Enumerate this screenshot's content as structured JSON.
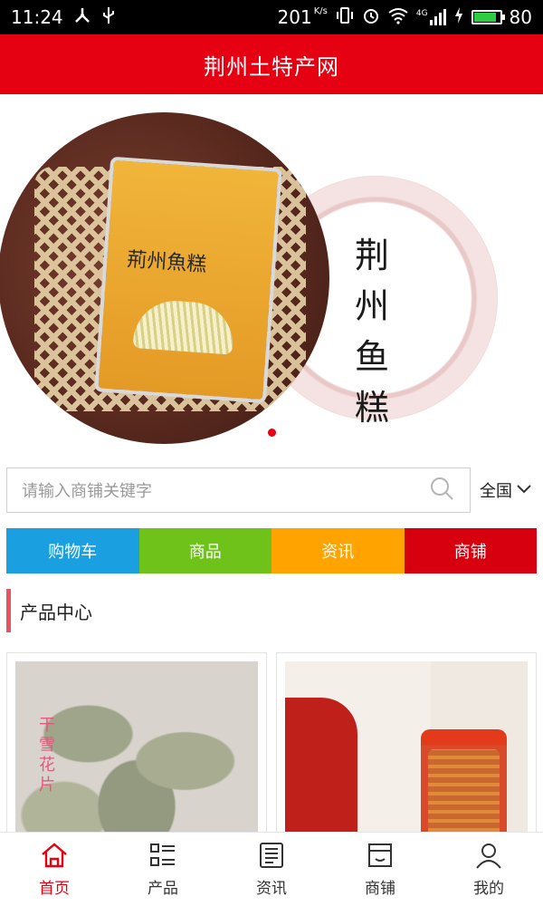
{
  "status_bar": {
    "time": "11:24",
    "speed": "201",
    "speed_unit": "K/s",
    "network": "4G",
    "battery": "80",
    "battery_level": 0.8
  },
  "header": {
    "title": "荆州土特产网"
  },
  "banner": {
    "product_text": "荊州魚糕",
    "calligraphy": [
      "荆",
      "州",
      "鱼",
      "糕"
    ]
  },
  "search": {
    "placeholder": "请输入商铺关键字",
    "region": "全国"
  },
  "quick_nav": [
    {
      "label": "购物车",
      "color": "#1a9fe0"
    },
    {
      "label": "商品",
      "color": "#6ec21a"
    },
    {
      "label": "资讯",
      "color": "#ffa300"
    },
    {
      "label": "商铺",
      "color": "#d7000f"
    }
  ],
  "section": {
    "title": "产品中心"
  },
  "products": [
    {
      "image_label": "干雪花片"
    },
    {
      "image_label": ""
    }
  ],
  "tabbar": [
    {
      "label": "首页",
      "icon": "home-icon",
      "active": true
    },
    {
      "label": "产品",
      "icon": "list-icon",
      "active": false
    },
    {
      "label": "资讯",
      "icon": "news-icon",
      "active": false
    },
    {
      "label": "商铺",
      "icon": "shop-icon",
      "active": false
    },
    {
      "label": "我的",
      "icon": "user-icon",
      "active": false
    }
  ],
  "colors": {
    "brand": "#e50012",
    "section_bar": "#e95262"
  }
}
